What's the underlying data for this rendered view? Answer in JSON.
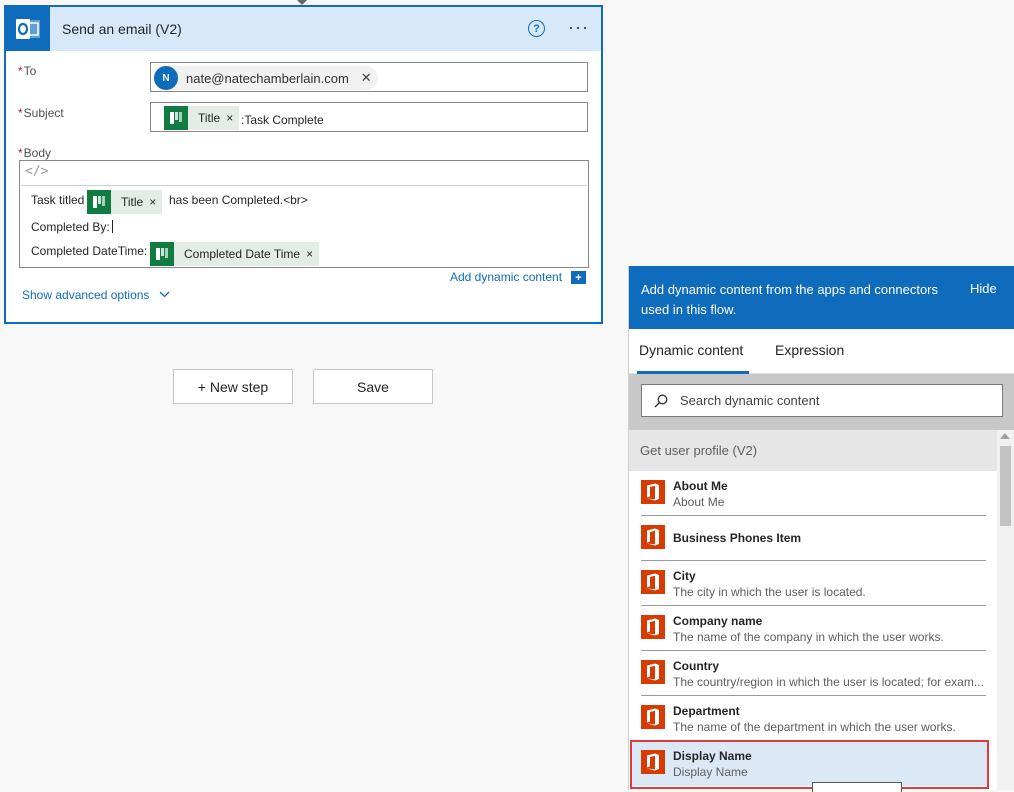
{
  "card": {
    "title": "Send an email (V2)",
    "help_symbol": "?",
    "more_symbol": "···",
    "to": {
      "label": "To",
      "required_mark": "*",
      "avatar_initial": "N",
      "email": "nate@natechamberlain.com",
      "remove_symbol": "✕"
    },
    "subject": {
      "label": "Subject",
      "required_mark": "*",
      "token_label": "Title",
      "token_remove": "×",
      "suffix_text": ":Task Complete"
    },
    "body": {
      "label": "Body",
      "required_mark": "*",
      "code_symbol": "</>",
      "line1_prefix": "Task titled",
      "line1_token": "Title",
      "line1_token_remove": "×",
      "line1_suffix": "has been Completed.<br>",
      "line2_text": "Completed By:",
      "line3_prefix": "Completed DateTime:",
      "line3_token": "Completed Date Time",
      "line3_token_remove": "×"
    },
    "add_dynamic_label": "Add dynamic content",
    "add_dynamic_symbol": "+",
    "advanced_label": "Show advanced options",
    "advanced_chevron": "⌵"
  },
  "buttons": {
    "new_step": "+ New step",
    "save": "Save"
  },
  "panel": {
    "description": "Add dynamic content from the apps and connectors used in this flow.",
    "hide_label": "Hide",
    "tabs": [
      "Dynamic content",
      "Expression"
    ],
    "search_placeholder": "Search dynamic content",
    "section_title": "Get user profile (V2)",
    "items": [
      {
        "name": "About Me",
        "sub": "About Me"
      },
      {
        "name": "Business Phones Item",
        "sub": ""
      },
      {
        "name": "City",
        "sub": "The city in which the user is located."
      },
      {
        "name": "Company name",
        "sub": "The name of the company in which the user works."
      },
      {
        "name": "Country",
        "sub": "The country/region in which the user is located; for exam..."
      },
      {
        "name": "Department",
        "sub": "The name of the department in which the user works."
      },
      {
        "name": "Display Name",
        "sub": "Display Name"
      }
    ]
  },
  "colors": {
    "accent": "#0f6cbd",
    "token_green": "#107c41",
    "office_orange": "#d83b01",
    "highlight_red": "#e03b3b"
  },
  "icons": {
    "card_icon": "outlook-icon",
    "token_icon": "planner-icon",
    "item_icon": "office365-icon",
    "search_icon": "search-icon"
  }
}
